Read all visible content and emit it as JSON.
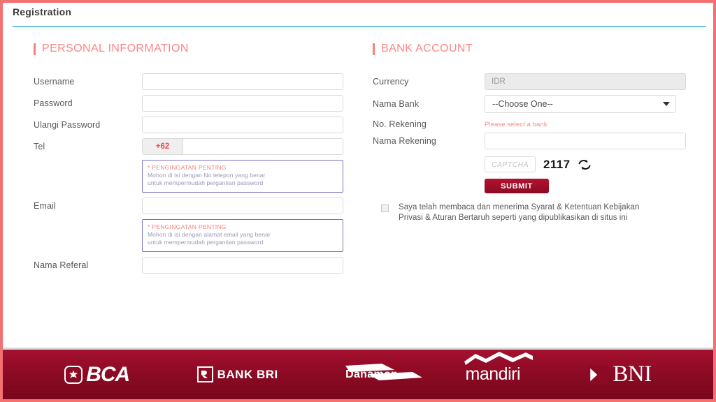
{
  "window": {
    "title": "Registration"
  },
  "personal": {
    "heading": "PERSONAL INFORMATION",
    "fields": {
      "username_label": "Username",
      "username_value": "",
      "password_label": "Password",
      "password_value": "",
      "repeat_password_label": "Ulangi Password",
      "repeat_password_value": "",
      "tel_label": "Tel",
      "tel_prefix": "+62",
      "tel_value": "",
      "email_label": "Email",
      "email_value": "",
      "referral_label": "Nama Referal",
      "referral_value": ""
    },
    "reminder_phone": {
      "title": "* PENGINGATAN PENTING",
      "line1": "Mohon di isi dengan No telepon yang benar",
      "line2": "untuk mempermudah pergantian password"
    },
    "reminder_email": {
      "title": "* PENGINGATAN PENTING",
      "line1": "Mohon di isi dengan alamat email yang benar",
      "line2": "untuk mempermudah pergantian password"
    }
  },
  "bank": {
    "heading": "BANK ACCOUNT",
    "fields": {
      "currency_label": "Currency",
      "currency_value": "IDR",
      "bank_name_label": "Nama Bank",
      "bank_name_selected": "--Choose One--",
      "account_number_label": "No. Rekening",
      "account_number_error": "Please select a bank",
      "account_number_value": "",
      "account_holder_label": "Nama Rekening",
      "account_holder_value": ""
    },
    "captcha": {
      "placeholder": "CAPTCHA",
      "value": "",
      "code": "2117",
      "refresh_icon": "refresh-icon"
    },
    "submit_label": "SUBMIT",
    "terms": {
      "checked": false,
      "line1": "Saya telah membaca dan menerima Syarat & Ketentuan",
      "line2": "Kebijakan Privasi & Aturan Bertaruh seperti yang",
      "line3": "dipublikasikan di situs ini"
    }
  },
  "footer": {
    "banks": [
      {
        "name": "BCA",
        "icon": "bca-logo-icon"
      },
      {
        "name": "BANK BRI",
        "icon": "bri-logo-icon"
      },
      {
        "name": "Danamon",
        "icon": "danamon-logo-icon"
      },
      {
        "name": "mandiri",
        "icon": "mandiri-logo-icon"
      },
      {
        "name": "BNI",
        "icon": "bni-logo-icon"
      }
    ]
  },
  "colors": {
    "border": "#f47171",
    "accent_heading": "#fb8784",
    "rule_blue": "#6ec2f0",
    "submit": "#a3102b",
    "footer": "#8c0a24",
    "reminder_border": "#7b74c4"
  }
}
